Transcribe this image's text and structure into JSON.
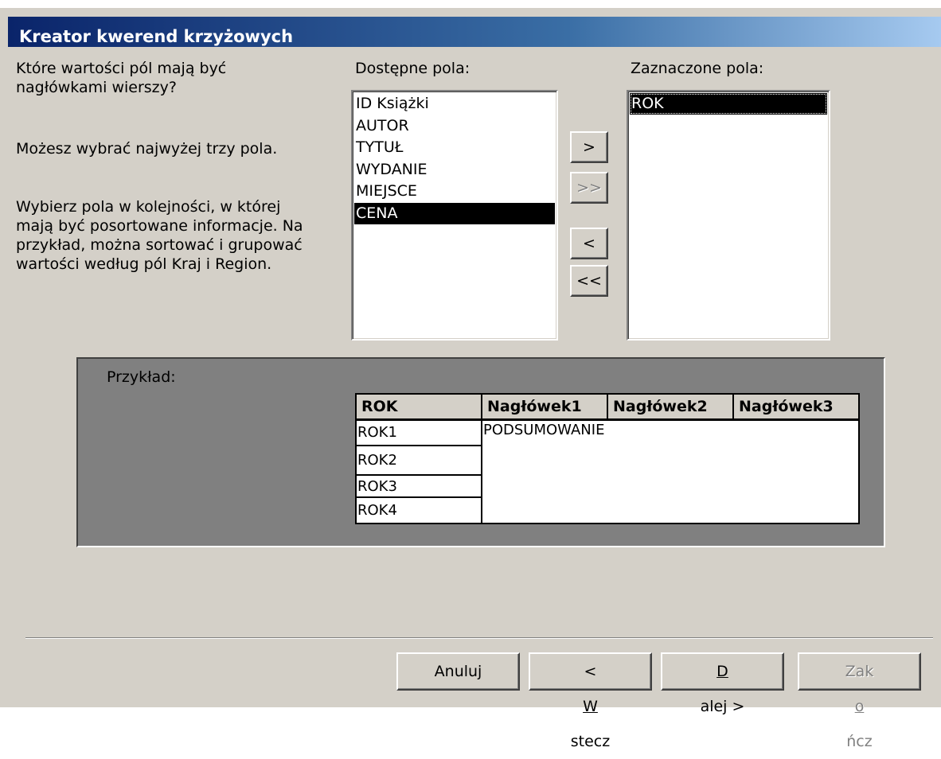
{
  "window": {
    "title": "Kreator kwerend krzyżowych"
  },
  "instructions": {
    "question_line1": "Które wartości pól mają być",
    "question_line2": "nagłówkami wierszy?",
    "limit": "Możesz wybrać najwyżej trzy pola.",
    "order_line1": "Wybierz pola w kolejności, w której",
    "order_line2": "mają być posortowane informacje. Na",
    "order_line3": "przykład, można sortować i grupować",
    "order_line4": "wartości według pól Kraj i Region."
  },
  "available": {
    "label": "Dostępne pola:",
    "items": [
      "ID Książki",
      "AUTOR",
      "TYTUŁ",
      "WYDANIE",
      "MIEJSCE",
      "CENA"
    ],
    "selected_item": "CENA"
  },
  "selected": {
    "label": "Zaznaczone pola:",
    "items": [
      "ROK"
    ]
  },
  "move_buttons": {
    "add_one": ">",
    "add_all": ">>",
    "remove_one": "<",
    "remove_all": "<<"
  },
  "example": {
    "label": "Przykład:",
    "headers": [
      "ROK",
      "Nagłówek1",
      "Nagłówek2",
      "Nagłówek3"
    ],
    "rows": [
      "ROK1",
      "ROK2",
      "ROK3",
      "ROK4"
    ],
    "summary": "PODSUMOWANIE"
  },
  "footer": {
    "cancel": "Anuluj",
    "back_prefix": "< ",
    "back_mnemonic": "W",
    "back_rest": "stecz",
    "next_mnemonic": "D",
    "next_rest": "alej >",
    "finish_pre": "Zak",
    "finish_mnemonic": "o",
    "finish_rest": "ńcz"
  },
  "colors": {
    "title_start": "#0a246a",
    "title_end": "#a6caf0",
    "face": "#d4d0c8",
    "example_bg": "#808080",
    "selection": "#000000"
  }
}
